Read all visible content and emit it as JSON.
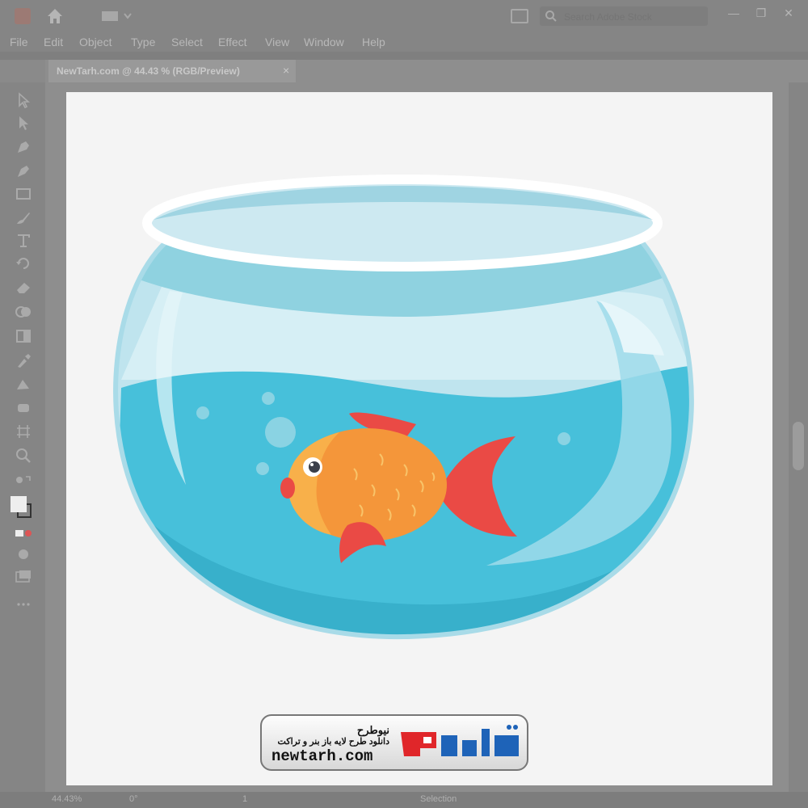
{
  "app": {
    "menu": [
      "File",
      "Edit",
      "Object",
      "Type",
      "Select",
      "Effect",
      "View",
      "Window",
      "Help"
    ],
    "search_placeholder": "Search Adobe Stock",
    "window_controls": [
      "—",
      "❐",
      "✕"
    ]
  },
  "document": {
    "tab_label": "NewTarh.com @ 44.43 % (RGB/Preview)",
    "close_label": "×"
  },
  "status": {
    "zoom": "44.43%",
    "rotation": "0°",
    "artboard": "1",
    "mode": "Selection"
  },
  "tools": [
    "selection-icon",
    "direct-selection-icon",
    "pen-icon",
    "curvature-icon",
    "rectangle-icon",
    "paintbrush-icon",
    "type-icon",
    "rotate-icon",
    "eraser-icon",
    "shape-builder-icon",
    "gradient-icon",
    "eyedropper-icon",
    "blend-icon",
    "symbol-sprayer-icon",
    "artboard-icon",
    "zoom-icon",
    "fill-stroke-icon",
    "drawing-modes-icon",
    "screen-mode-icon",
    "more-tools-icon"
  ],
  "watermark": {
    "brand_fa": "نیوطرح",
    "tagline_fa": "دانلود طرح لایه باز بنر و تراکت",
    "url": "newtarh.com",
    "logo_text_fa": "نیوطرح"
  },
  "colors": {
    "water": "#3fb8d4",
    "glass": "#bfe4ee",
    "fish_body": "#f4963a",
    "fish_fin": "#ea4a45",
    "logo_red": "#e0262a",
    "logo_blue": "#1e63b8"
  }
}
